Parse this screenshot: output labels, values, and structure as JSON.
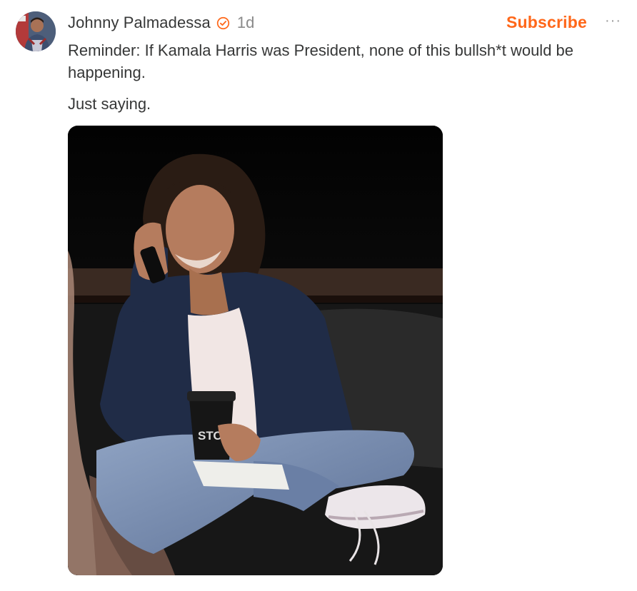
{
  "post": {
    "author": "Johnny Palmadessa",
    "timestamp": "1d",
    "subscribe_label": "Subscribe",
    "more_label": "···",
    "paragraphs": [
      "Reminder: If Kamala Harris was President, none of this bullsh*t would be happening.",
      "Just saying."
    ],
    "image": {
      "cup_text": "STO"
    }
  },
  "colors": {
    "accent": "#ff6719",
    "text": "#363737",
    "muted": "#8a8a8a"
  },
  "icons": {
    "verified": "verified-badge-icon",
    "more": "more-options-icon"
  }
}
